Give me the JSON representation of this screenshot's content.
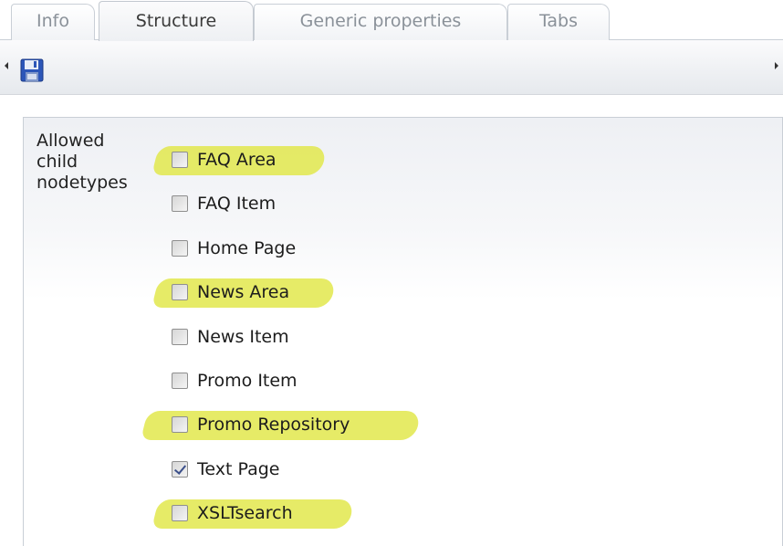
{
  "tabs": [
    {
      "label": "Info",
      "active": false
    },
    {
      "label": "Structure",
      "active": true
    },
    {
      "label": "Generic properties",
      "active": false
    },
    {
      "label": "Tabs",
      "active": false
    }
  ],
  "toolbar": {
    "save_icon": "floppy-disk-icon"
  },
  "property": {
    "label": "Allowed\nchild\nnodetypes"
  },
  "colors": {
    "highlight": "#e2e84c",
    "checkmark": "#3b4f8a",
    "floppy": "#2c56b8"
  },
  "nodetypes": [
    {
      "label": "FAQ Area",
      "checked": false,
      "highlighted": true
    },
    {
      "label": "FAQ Item",
      "checked": false,
      "highlighted": false
    },
    {
      "label": "Home Page",
      "checked": false,
      "highlighted": false
    },
    {
      "label": "News Area",
      "checked": false,
      "highlighted": true
    },
    {
      "label": "News Item",
      "checked": false,
      "highlighted": false
    },
    {
      "label": "Promo Item",
      "checked": false,
      "highlighted": false
    },
    {
      "label": "Promo Repository",
      "checked": false,
      "highlighted": true
    },
    {
      "label": "Text Page",
      "checked": true,
      "highlighted": false
    },
    {
      "label": "XSLTsearch",
      "checked": false,
      "highlighted": true
    }
  ]
}
